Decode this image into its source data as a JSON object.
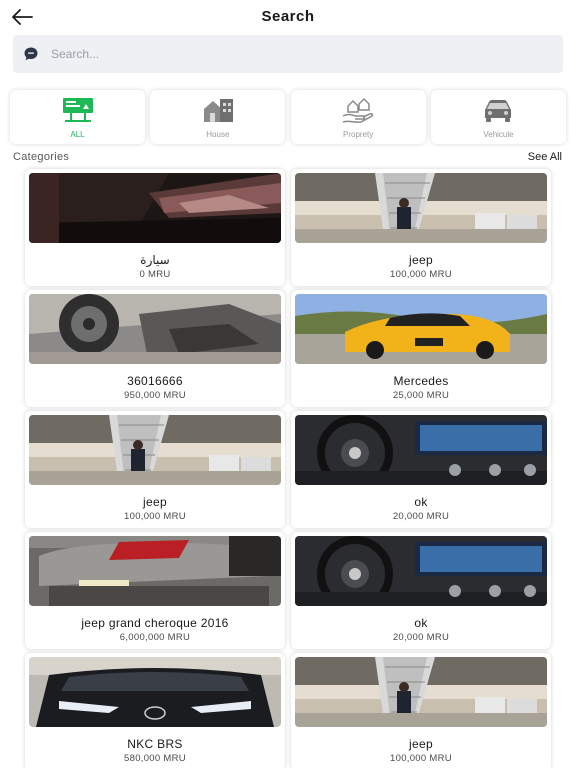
{
  "header": {
    "title": "Search",
    "back_icon": "arrow-left-icon"
  },
  "search": {
    "placeholder": "Search...",
    "value": "",
    "icon": "chat-search-icon"
  },
  "categories_tabs": [
    {
      "label": "ALL",
      "icon": "billboard-icon",
      "active": true
    },
    {
      "label": "House",
      "icon": "house-icon",
      "active": false
    },
    {
      "label": "Proprety",
      "icon": "property-hand-icon",
      "active": false
    },
    {
      "label": "Vehicule",
      "icon": "car-icon",
      "active": false
    }
  ],
  "section": {
    "title": "Categories",
    "see_all": "See All"
  },
  "listings": [
    {
      "name": "سيارة",
      "price": "0 MRU",
      "image": "car-interior-night"
    },
    {
      "name": "jeep",
      "price": "100,000 MRU",
      "image": "man-airplane-stairs"
    },
    {
      "name": "36016666",
      "price": "950,000 MRU",
      "image": "car-wheel-closeup"
    },
    {
      "name": "Mercedes",
      "price": "25,000 MRU",
      "image": "yellow-sports-car"
    },
    {
      "name": "jeep",
      "price": "100,000 MRU",
      "image": "man-airplane-stairs"
    },
    {
      "name": "ok",
      "price": "20,000 MRU",
      "image": "mercedes-dashboard"
    },
    {
      "name": "jeep grand cheroque 2016",
      "price": "6,000,000 MRU",
      "image": "jeep-rear"
    },
    {
      "name": "ok",
      "price": "20,000 MRU",
      "image": "mercedes-dashboard"
    },
    {
      "name": "NKC BRS",
      "price": "580,000 MRU",
      "image": "toyota-front"
    },
    {
      "name": "jeep",
      "price": "100,000 MRU",
      "image": "man-airplane-stairs"
    }
  ],
  "colors": {
    "accent": "#1db954",
    "search_bg": "#eef0f3",
    "icon_gray": "#9a9a9a"
  }
}
